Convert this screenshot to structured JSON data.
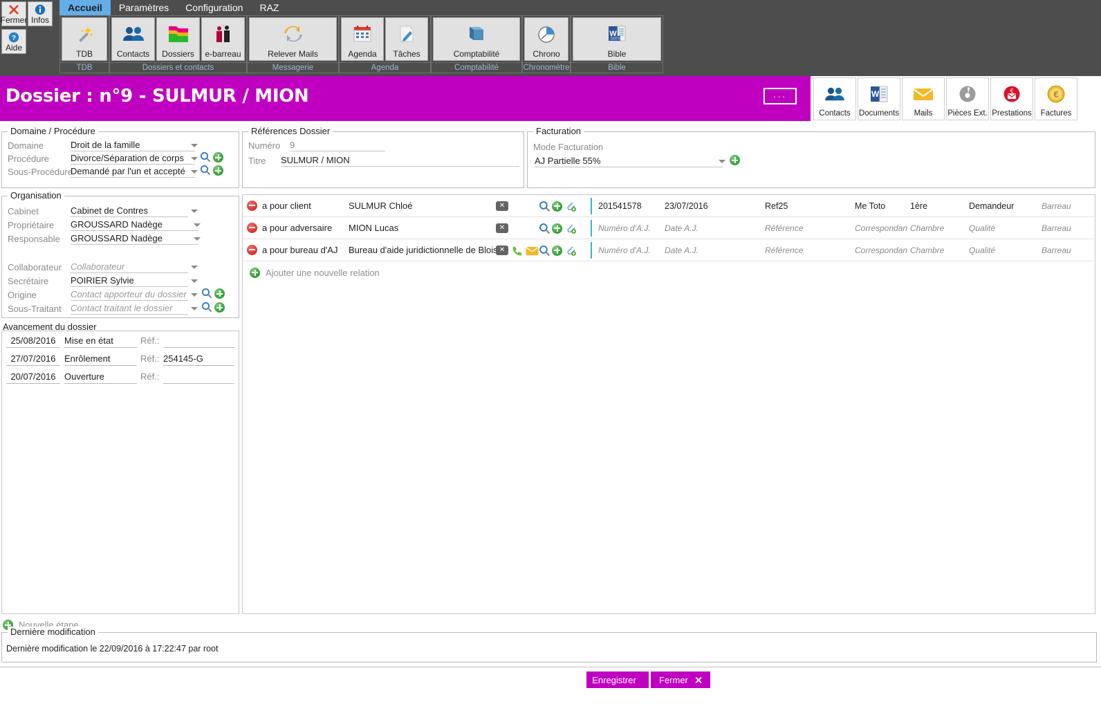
{
  "quick": {
    "fermer": "Fermer",
    "infos": "Infos",
    "aide": "Aide"
  },
  "menu": {
    "tabs": [
      {
        "label": "Accueil",
        "active": true
      },
      {
        "label": "Paramètres",
        "active": false
      },
      {
        "label": "Configuration",
        "active": false
      },
      {
        "label": "RAZ",
        "active": false
      }
    ]
  },
  "ribbon": {
    "groups": [
      {
        "label": "TDB",
        "buttons": [
          {
            "caption": "TDB",
            "icon": "magic-wand-icon",
            "accel": "T"
          }
        ]
      },
      {
        "label": "Dossiers et contacts",
        "buttons": [
          {
            "caption": "Contacts",
            "icon": "contacts-icon",
            "accel": "C"
          },
          {
            "caption": "Dossiers",
            "icon": "folders-icon",
            "accel": "D"
          },
          {
            "caption": "e-barreau",
            "icon": "people-bar-icon",
            "accel": ""
          }
        ]
      },
      {
        "label": "Messagerie",
        "buttons": [
          {
            "caption": "Relever Mails",
            "icon": "refresh-mail-icon",
            "accel": ""
          }
        ]
      },
      {
        "label": "Agenda",
        "buttons": [
          {
            "caption": "Agenda",
            "icon": "calendar-icon",
            "accel": ""
          },
          {
            "caption": "Tâches",
            "icon": "task-pencil-icon",
            "accel": ""
          }
        ]
      },
      {
        "label": "Comptabilité",
        "buttons": [
          {
            "caption": "Comptabilité",
            "icon": "ledger-book-icon",
            "accel": ""
          }
        ]
      },
      {
        "label": "Chronomètre",
        "buttons": [
          {
            "caption": "Chrono",
            "icon": "stopwatch-icon",
            "accel": ""
          }
        ]
      },
      {
        "label": "Bible",
        "buttons": [
          {
            "caption": "Bible",
            "icon": "word-dotx-icon",
            "accel": "B"
          }
        ]
      }
    ]
  },
  "header": {
    "title": "Dossier : n°9 - SULMUR / MION",
    "more_button": "...",
    "accent_color": "#c000c0",
    "actions": [
      {
        "caption": "Contacts",
        "icon": "contacts-icon"
      },
      {
        "caption": "Documents",
        "icon": "word-doc-icon"
      },
      {
        "caption": "Mails",
        "icon": "envelope-icon"
      },
      {
        "caption": "Pièces Ext.",
        "icon": "disc-icon"
      },
      {
        "caption": "Prestations",
        "icon": "euro-mail-icon"
      },
      {
        "caption": "Factures",
        "icon": "euro-coin-icon"
      }
    ]
  },
  "domaine": {
    "caption": "Domaine / Procédure",
    "fields": [
      {
        "label": "Domaine",
        "value": "Droit de la famille",
        "placeholder": false
      },
      {
        "label": "Procédure",
        "value": "Divorce/Séparation de corps",
        "placeholder": false
      },
      {
        "label": "Sous-Procédure",
        "value": "Demandé par l'un et accepté",
        "placeholder": false
      }
    ]
  },
  "references": {
    "caption": "Références Dossier",
    "numero_label": "Numéro",
    "numero_value": "9",
    "titre_label": "Titre",
    "titre_value": "SULMUR / MION"
  },
  "facturation": {
    "caption": "Facturation",
    "mode_label": "Mode Facturation",
    "mode_value": "AJ Partielle 55%"
  },
  "organisation": {
    "caption": "Organisation",
    "fields": [
      {
        "label": "Cabinet",
        "value": "Cabinet de Contres",
        "placeholder": false
      },
      {
        "label": "Propriétaire",
        "value": "GROUSSARD  Nadège",
        "placeholder": false
      },
      {
        "label": "Responsable",
        "value": "GROUSSARD Nadège",
        "placeholder": false
      },
      {
        "label": "Collaborateur",
        "value": "Collaborateur",
        "placeholder": true
      },
      {
        "label": "Secrétaire",
        "value": "POIRIER Sylvie",
        "placeholder": false
      },
      {
        "label": "Origine",
        "value": "Contact apporteur du dossier",
        "placeholder": true
      },
      {
        "label": "Sous-Traitant",
        "value": "Contact traitant le dossier",
        "placeholder": true
      }
    ]
  },
  "avancement": {
    "caption": "Avancement du dossier",
    "ref_label": "Réf.:",
    "steps": [
      {
        "date": "25/08/2016",
        "label": "Mise en état",
        "ref": ""
      },
      {
        "date": "27/07/2016",
        "label": "Enrôlement",
        "ref": "254145-G"
      },
      {
        "date": "20/07/2016",
        "label": "Ouverture",
        "ref": ""
      }
    ],
    "new_step": "Nouvelle étape"
  },
  "relations": {
    "add_label": "Ajouter une nouvelle relation",
    "rows": [
      {
        "type": "a pour client",
        "name": "SULMUR Chloé",
        "has_phone": false,
        "has_mail": false,
        "cells": [
          {
            "text": "201541578",
            "placeholder": false
          },
          {
            "text": "23/07/2016",
            "placeholder": false
          },
          {
            "text": "Ref25",
            "placeholder": false
          },
          {
            "text": "Me Toto",
            "placeholder": false
          },
          {
            "text": "1ère",
            "placeholder": false
          },
          {
            "text": "Demandeur",
            "placeholder": false
          },
          {
            "text": "Barreau",
            "placeholder": true
          }
        ]
      },
      {
        "type": "a pour adversaire",
        "name": "MION Lucas",
        "has_phone": false,
        "has_mail": false,
        "cells": [
          {
            "text": "Numéro d'A.J.",
            "placeholder": true
          },
          {
            "text": "Date A.J.",
            "placeholder": true
          },
          {
            "text": "Référence",
            "placeholder": true
          },
          {
            "text": "Correspondan",
            "placeholder": true
          },
          {
            "text": "Chambre",
            "placeholder": true
          },
          {
            "text": "Qualité",
            "placeholder": true
          },
          {
            "text": "Barreau",
            "placeholder": true
          }
        ]
      },
      {
        "type": "a pour bureau d'AJ",
        "name": "Bureau d'aide juridictionnelle de Blois",
        "has_phone": true,
        "has_mail": true,
        "cells": [
          {
            "text": "Numéro d'A.J.",
            "placeholder": true
          },
          {
            "text": "Date A.J.",
            "placeholder": true
          },
          {
            "text": "Référence",
            "placeholder": true
          },
          {
            "text": "Correspondan",
            "placeholder": true
          },
          {
            "text": "Chambre",
            "placeholder": true
          },
          {
            "text": "Qualité",
            "placeholder": true
          },
          {
            "text": "Barreau",
            "placeholder": true
          }
        ]
      }
    ]
  },
  "lastmod": {
    "caption": "Dernière modification",
    "text": "Dernière modification le 22/09/2016 à 17:22:47 par root"
  },
  "footer": {
    "save": "Enregistrer",
    "close": "Fermer"
  }
}
